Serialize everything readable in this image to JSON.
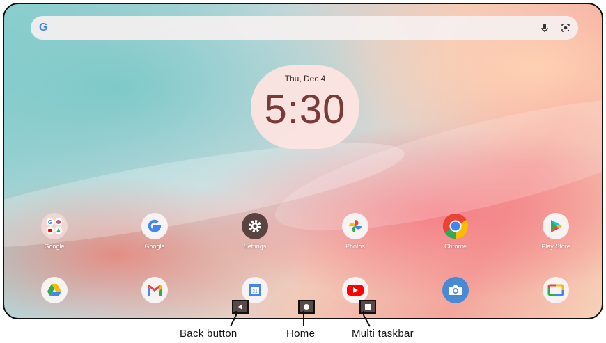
{
  "search": {
    "logo": "G",
    "mic_icon": "mic-icon",
    "lens_icon": "lens-icon"
  },
  "clock": {
    "date": "Thu, Dec 4",
    "time": "5:30"
  },
  "apps_row1": [
    {
      "label": "Google",
      "icon": "google-folder-icon"
    },
    {
      "label": "Google",
      "icon": "google-icon"
    },
    {
      "label": "Settings",
      "icon": "settings-gear-icon"
    },
    {
      "label": "Photos",
      "icon": "photos-pinwheel-icon"
    },
    {
      "label": "Chrome",
      "icon": "chrome-icon"
    },
    {
      "label": "Play Store",
      "icon": "play-store-icon"
    }
  ],
  "dock": [
    {
      "icon": "drive-icon"
    },
    {
      "icon": "gmail-icon"
    },
    {
      "icon": "calendar-icon",
      "text": "31"
    },
    {
      "icon": "youtube-icon"
    },
    {
      "icon": "camera-icon"
    },
    {
      "icon": "google-tv-icon"
    }
  ],
  "nav": {
    "back_icon": "back-triangle-icon",
    "home_icon": "home-circle-icon",
    "recents_icon": "recents-square-icon"
  },
  "annotations": {
    "back": "Back button",
    "home": "Home",
    "recents": "Multi taskbar"
  }
}
